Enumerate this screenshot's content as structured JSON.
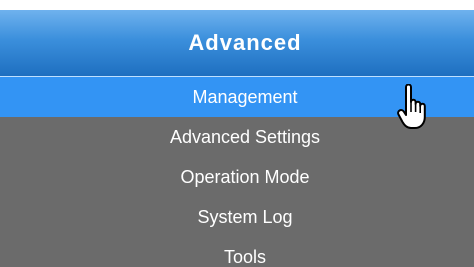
{
  "header": {
    "title": "Advanced"
  },
  "menu": {
    "items": [
      {
        "label": "Management",
        "active": true
      },
      {
        "label": "Advanced Settings",
        "active": false
      },
      {
        "label": "Operation Mode",
        "active": false
      },
      {
        "label": "System Log",
        "active": false
      },
      {
        "label": "Tools",
        "active": false
      }
    ]
  },
  "cursor": {
    "icon": "hand-pointer-icon"
  },
  "colors": {
    "header_top": "#6fb2ee",
    "header_bottom": "#1e6fc0",
    "active_item": "#3394f4",
    "menu_background": "#6b6b6b",
    "text": "#ffffff"
  }
}
